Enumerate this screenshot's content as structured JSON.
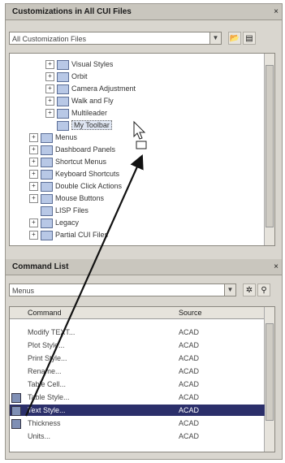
{
  "customizations_panel": {
    "title": "Customizations in All CUI Files",
    "pin_glyph": "×",
    "filter_value": "All Customization Files",
    "tree_items": [
      {
        "label": "Visual Styles",
        "indent": 2,
        "expander": "+"
      },
      {
        "label": "Orbit",
        "indent": 2,
        "expander": "+"
      },
      {
        "label": "Camera Adjustment",
        "indent": 2,
        "expander": "+"
      },
      {
        "label": "Walk and Fly",
        "indent": 2,
        "expander": "+"
      },
      {
        "label": "Multileader",
        "indent": 2,
        "expander": "+"
      },
      {
        "label": "My Toolbar",
        "indent": 2,
        "expander": "",
        "selected": true
      },
      {
        "label": "Menus",
        "indent": 1,
        "expander": "+"
      },
      {
        "label": "Dashboard Panels",
        "indent": 1,
        "expander": "+"
      },
      {
        "label": "Shortcut Menus",
        "indent": 1,
        "expander": "+"
      },
      {
        "label": "Keyboard Shortcuts",
        "indent": 1,
        "expander": "+"
      },
      {
        "label": "Double Click Actions",
        "indent": 1,
        "expander": "+"
      },
      {
        "label": "Mouse Buttons",
        "indent": 1,
        "expander": "+"
      },
      {
        "label": "LISP Files",
        "indent": 1,
        "expander": ""
      },
      {
        "label": "Legacy",
        "indent": 1,
        "expander": "+"
      },
      {
        "label": "Partial CUI Files",
        "indent": 1,
        "expander": "+"
      }
    ]
  },
  "command_list_panel": {
    "title": "Command List",
    "pin_glyph": "×",
    "filter_value": "Menus",
    "columns": {
      "command": "Command",
      "source": "Source"
    },
    "rows": [
      {
        "name": "Modify TEXT...",
        "source": "ACAD"
      },
      {
        "name": "Plot Style...",
        "source": "ACAD"
      },
      {
        "name": "Print Style...",
        "source": "ACAD"
      },
      {
        "name": "Rename...",
        "source": "ACAD"
      },
      {
        "name": "Table Cell...",
        "source": "ACAD"
      },
      {
        "name": "Table Style...",
        "source": "ACAD"
      },
      {
        "name": "Text Style...",
        "source": "ACAD",
        "selected": true
      },
      {
        "name": "Thickness",
        "source": "ACAD"
      },
      {
        "name": "Units...",
        "source": "ACAD"
      }
    ]
  },
  "colors": {
    "selection": "#2b2f6a",
    "arrow": "#111111"
  }
}
